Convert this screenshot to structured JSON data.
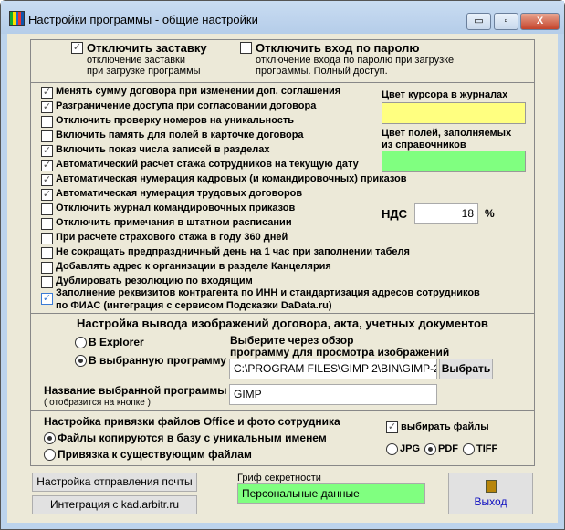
{
  "window": {
    "title": "Настройки программы - общие настройки",
    "minimize": "▭",
    "maximize": "▫",
    "close": "X"
  },
  "top": {
    "splash": {
      "label": "Отключить заставку",
      "desc1": "отключение заставки",
      "desc2": "при загрузке программы",
      "checked": true
    },
    "password": {
      "label": "Отключить вход по паролю",
      "desc1": "отключение входа по паролю при загрузке",
      "desc2": "программы. Полный доступ.",
      "checked": false
    }
  },
  "options": [
    {
      "label": "Менять сумму договора при изменении доп. соглашения",
      "checked": true
    },
    {
      "label": "Разграничение доступа при согласовании договора",
      "checked": true
    },
    {
      "label": "Отключить проверку номеров на уникальность",
      "checked": false
    },
    {
      "label": "Включить память для полей в карточке договора",
      "checked": false
    },
    {
      "label": "Включить показ числа записей в разделах",
      "checked": true
    },
    {
      "label": "Автоматический расчет стажа сотрудников на текущую дату",
      "checked": true
    },
    {
      "label": "Автоматическая нумерация кадровых (и командировочных) приказов",
      "checked": true
    },
    {
      "label": "Автоматическая нумерация трудовых договоров",
      "checked": true
    },
    {
      "label": "Отключить журнал командировочных приказов",
      "checked": false
    },
    {
      "label": "Отключить примечания в штатном расписании",
      "checked": false
    },
    {
      "label": "При расчете страхового стажа в году 360 дней",
      "checked": false
    },
    {
      "label": "Не сокращать предпраздничный день на 1 час при заполнении табеля",
      "checked": false
    },
    {
      "label": "Добавлять адрес к организации в разделе Канцелярия",
      "checked": false
    },
    {
      "label": "Дублировать резолюцию по входящим",
      "checked": false
    }
  ],
  "dadata": {
    "line1": "Заполнение реквизитов контрагента по ИНН и стандартизация адресов сотрудников",
    "line2": "по ФИАС (интеграция с сервисом Подсказки DaData.ru)",
    "checked": true
  },
  "colors": {
    "cursor_label": "Цвет курсора в журналах",
    "cursor_color": "#ffff80",
    "fields_label1": "Цвет полей, заполняемых",
    "fields_label2": "из справочников",
    "fields_color": "#80ff80"
  },
  "vat": {
    "label": "НДС",
    "value": "18",
    "unit": "%"
  },
  "images": {
    "header": "Настройка вывода изображений договора,  акта, учетных документов",
    "explorer": "В Explorer",
    "selected_program": "В выбранную программу",
    "selected": "selected_program",
    "browse_hint1": "Выберите через обзор",
    "browse_hint2": "программу для просмотра изображений",
    "path": "C:\\PROGRAM FILES\\GIMP 2\\BIN\\GIMP-2",
    "choose_button": "Выбрать",
    "name_label": "Название выбранной программы",
    "name_sublabel": "( отобразится на кнопке )",
    "name_value": "GIMP"
  },
  "files": {
    "header": "Настройка привязки файлов Office и фото сотрудника",
    "copy_unique": "Файлы копируются в базу с уникальным именем",
    "link_existing": "Привязка к существующим файлам",
    "selected": "copy_unique",
    "choose_files": "выбирать файлы",
    "choose_files_checked": true,
    "formats": [
      "JPG",
      "PDF",
      "TIFF"
    ],
    "format_selected": "PDF"
  },
  "bottom": {
    "mail_button": "Настройка отправления почты",
    "kad_button": "Интеграция с kad.arbitr.ru",
    "secrecy_label": "Гриф секретности",
    "secrecy_value": "Персональные данные",
    "exit_button": "Выход"
  }
}
